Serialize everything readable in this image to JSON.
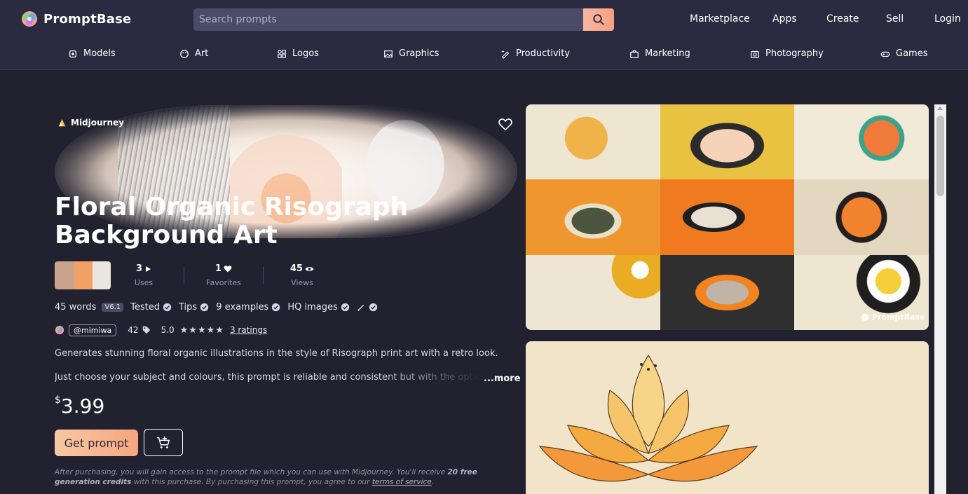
{
  "header": {
    "brand": "PromptBase",
    "search_placeholder": "Search prompts",
    "nav": [
      "Marketplace",
      "Apps",
      "Create",
      "Sell",
      "Login"
    ]
  },
  "subnav": [
    {
      "label": "Models",
      "icon": "models-icon"
    },
    {
      "label": "Art",
      "icon": "palette-icon"
    },
    {
      "label": "Logos",
      "icon": "shapes-icon"
    },
    {
      "label": "Graphics",
      "icon": "image-icon"
    },
    {
      "label": "Productivity",
      "icon": "pen-icon"
    },
    {
      "label": "Marketing",
      "icon": "briefcase-icon"
    },
    {
      "label": "Photography",
      "icon": "camera-icon"
    },
    {
      "label": "Games",
      "icon": "gamepad-icon"
    }
  ],
  "prompt": {
    "model": "Midjourney",
    "title": "Floral Organic Risograph Background Art",
    "stats": [
      {
        "value": "3",
        "label": "Uses",
        "icon": "play-icon"
      },
      {
        "value": "1",
        "label": "Favorites",
        "icon": "heart-icon"
      },
      {
        "value": "45",
        "label": "Views",
        "icon": "eye-icon"
      }
    ],
    "features": {
      "words": "45 words",
      "version": "V6.1",
      "tested": "Tested",
      "tips": "Tips",
      "examples": "9 examples",
      "hq": "HQ images"
    },
    "creator": "@mimiwa",
    "tag_count": "42",
    "rating": "5.0",
    "stars": 5,
    "ratings_link": "3 ratings",
    "description_1": "Generates stunning floral organic illustrations in the style of Risograph print art with a retro look.",
    "description_2": "Just choose your subject and colours, this prompt is reliable and consistent but with the option to vary th",
    "more": "...more",
    "currency": "$",
    "price": "3.99",
    "buy_label": "Get prompt",
    "fine_print_1": "After purchasing, you will gain access to the prompt file which you can use with Midjourney. You'll receive ",
    "fine_print_bold": "20 free generation credits",
    "fine_print_2": " with this purchase. By purchasing this prompt, you agree to our ",
    "terms_link": "terms of service",
    "fine_print_end": "."
  },
  "gallery": {
    "watermark": "PromptBase"
  },
  "colors": {
    "background": "#21212f",
    "header": "#2a2b40",
    "accent": "#f6a57f"
  }
}
